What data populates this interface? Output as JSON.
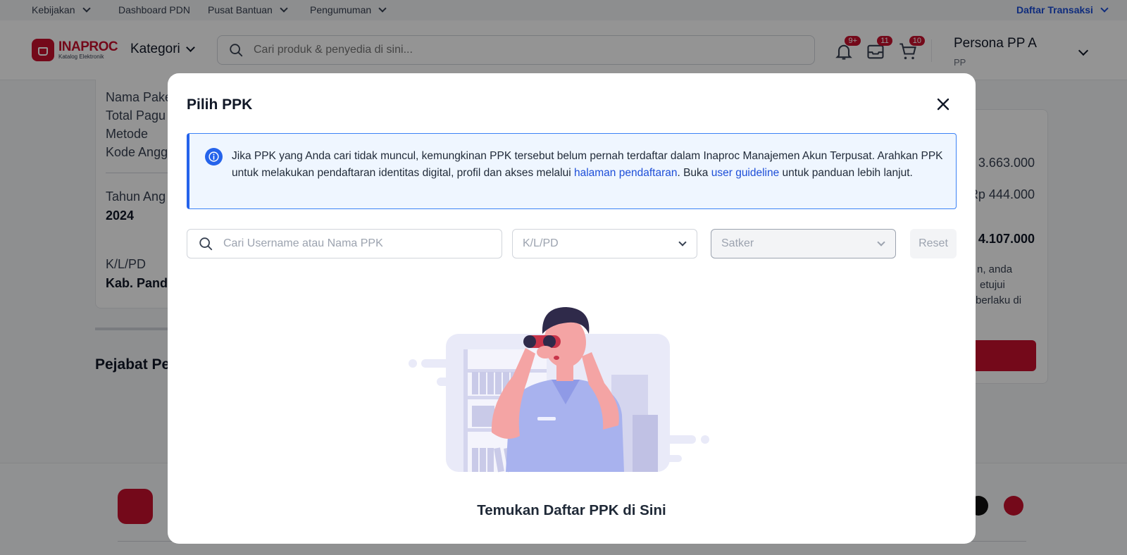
{
  "topbar": {
    "items": [
      "Kebijakan",
      "Dashboard PDN",
      "Pusat Bantuan",
      "Pengumuman"
    ],
    "transactions": "Daftar Transaksi"
  },
  "header": {
    "logo_text": "INAPROC",
    "logo_sub": "Katalog Elektronik",
    "category": "Kategori",
    "search_placeholder": "Cari produk & penyedia di sini...",
    "badges": {
      "notifications": "9+",
      "inbox": "11",
      "cart": "10"
    },
    "user_name": "Persona PP A",
    "user_role": "PP"
  },
  "background": {
    "fields": [
      "Nama Pake",
      "Total Pagu",
      "Metode",
      "Kode Angg"
    ],
    "year_label": "Tahun Ang",
    "year_value": "2024",
    "klpd_label": "K/L/PD",
    "klpd_value": "Kab. Pande",
    "section_title": "Pejabat Pe",
    "summary": {
      "amount1": "3.663.000",
      "amount2": "Rp 444.000",
      "total": "4.107.000",
      "text": [
        "n, anda",
        "etujui",
        "berlaku di"
      ]
    }
  },
  "modal": {
    "title": "Pilih PPK",
    "info_text_1": "Jika PPK yang Anda cari tidak muncul, kemungkinan PPK tersebut belum pernah terdaftar dalam Inaproc Manajemen Akun Terpusat. Arahkan PPK untuk melakukan pendaftaran identitas digital, profil dan akses melalui ",
    "info_link_1": "halaman pendaftaran",
    "info_text_2": ". Buka ",
    "info_link_2": "user guideline",
    "info_text_3": " untuk panduan lebih lanjut.",
    "search_placeholder": "Cari Username atau Nama PPK",
    "klpd_placeholder": "K/L/PD",
    "satker_placeholder": "Satker",
    "reset_label": "Reset",
    "empty_caption": "Temukan Daftar PPK di Sini"
  },
  "colors": {
    "brand": "#c8102e",
    "link": "#1d4ed8",
    "info_border": "#2563eb",
    "info_bg": "#eff6ff"
  }
}
